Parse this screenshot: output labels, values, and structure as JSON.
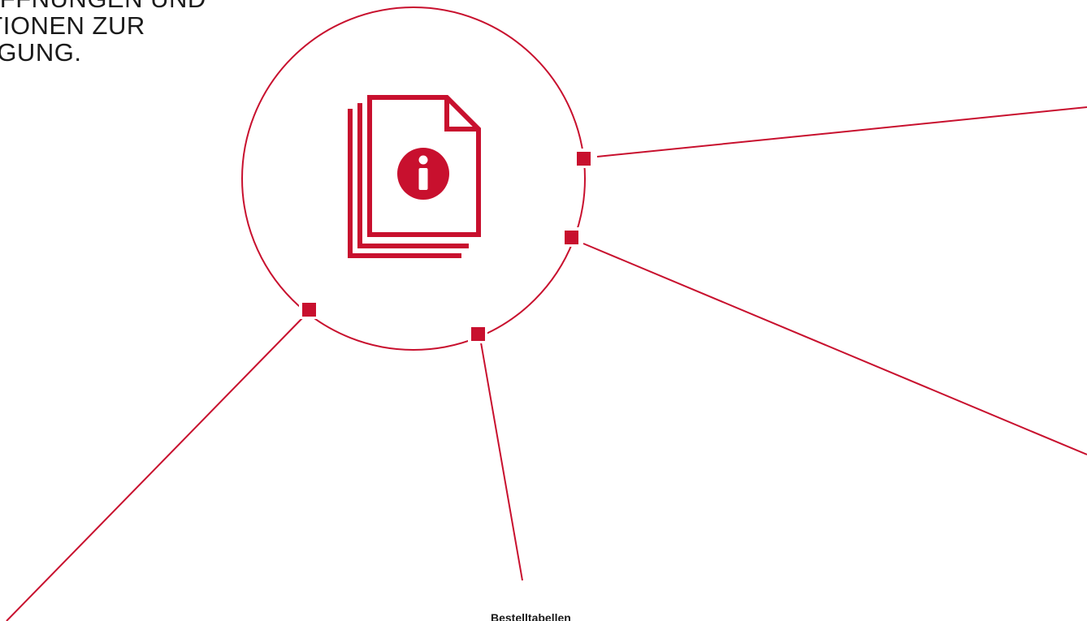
{
  "heading": {
    "lines": [
      "...N UND",
      "...IKTIONEN ZUR",
      "...FÜGUNG."
    ],
    "line1": "OPFFNUNGEN UND",
    "line2": "IKTIONEN ZUR",
    "line3": "FÜGUNG."
  },
  "hub": {
    "icon": "document-info-icon"
  },
  "labels": {
    "bottom": "Bestelltabellen"
  },
  "colors": {
    "accent": "#c8102e",
    "text": "#1a1a1a",
    "background": "#ffffff"
  }
}
